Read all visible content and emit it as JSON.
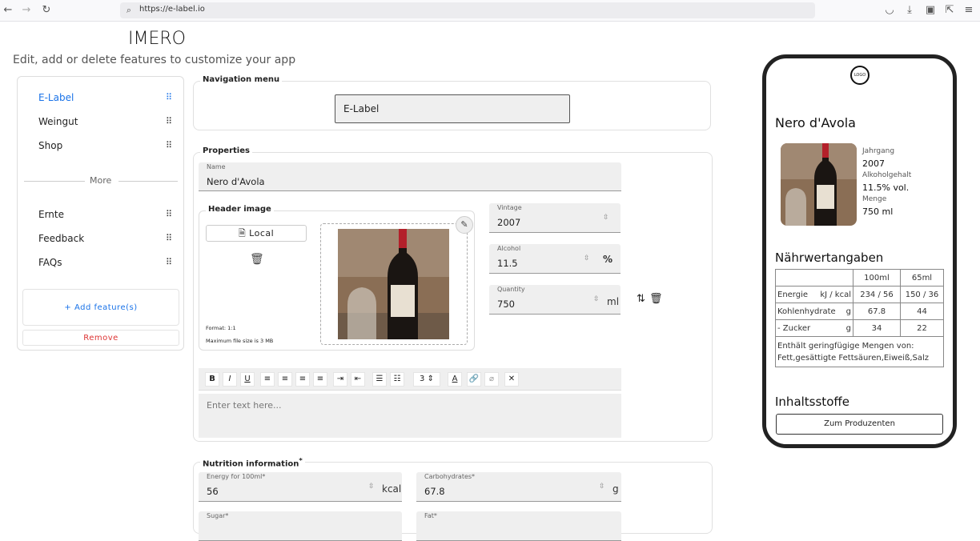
{
  "browser": {
    "url": "https://e-label.io"
  },
  "header": {
    "logo": "IMERO",
    "subtitle": "Edit, add or delete features to customize your app"
  },
  "sidebar": {
    "items": [
      {
        "label": "E-Label"
      },
      {
        "label": "Weingut"
      },
      {
        "label": "Shop"
      }
    ],
    "more_label": "More",
    "more_items": [
      {
        "label": "Ernte"
      },
      {
        "label": "Feedback"
      },
      {
        "label": "FAQs"
      }
    ],
    "add_feature": "+ Add feature(s)",
    "remove": "Remove"
  },
  "navigation_menu": {
    "legend": "Navigation menu",
    "value": "E-Label"
  },
  "properties": {
    "legend": "Properties",
    "name_label": "Name",
    "name_value": "Nero d'Avola",
    "header_image": {
      "legend": "Header image",
      "local_button": "Local",
      "format": "Format: 1:1",
      "max_size": "Maximum file size is 3 MB"
    },
    "vintage_label": "Vintage",
    "vintage_value": "2007",
    "alcohol_label": "Alcohol",
    "alcohol_value": "11.5",
    "alcohol_unit": "%",
    "quantity_label": "Quantity",
    "quantity_value": "750",
    "quantity_unit": "ml",
    "editor": {
      "font_size": "3",
      "placeholder": "Enter text here..."
    }
  },
  "nutrition": {
    "legend": "Nutrition information",
    "required_mark": "*",
    "energy_label": "Energy for 100ml*",
    "energy_value": "56",
    "energy_unit": "kcal",
    "carbs_label": "Carbohydrates*",
    "carbs_value": "67.8",
    "carbs_unit": "g",
    "sugar_label": "Sugar*",
    "fat_label": "Fat*"
  },
  "preview": {
    "logo": "LOGO",
    "title": "Nero d'Avola",
    "vintage_label": "Jahrgang",
    "vintage_value": "2007",
    "alcohol_label": "Alkoholgehalt",
    "alcohol_value": "11.5% vol.",
    "quantity_label": "Menge",
    "quantity_value": "750 ml",
    "nutrition_title": "Nährwertangaben",
    "table": {
      "headers": [
        "100ml",
        "65ml"
      ],
      "rows": [
        {
          "name": "Energie",
          "unit": "kJ / kcal",
          "v100": "234 / 56",
          "v65": "150 / 36"
        },
        {
          "name": "Kohlenhydrate",
          "unit": "g",
          "v100": "67.8",
          "v65": "44"
        },
        {
          "name": "- Zucker",
          "unit": "g",
          "v100": "34",
          "v65": "22"
        }
      ],
      "footnote": "Enthält geringfügige Mengen von: Fett,gesättigte Fettsäuren,Eiweiß,Salz"
    },
    "ingredients_title": "Inhaltsstoffe",
    "producer_button": "Zum Produzenten"
  },
  "colors": {
    "accent": "#1a73e8",
    "danger": "#dd3333"
  }
}
